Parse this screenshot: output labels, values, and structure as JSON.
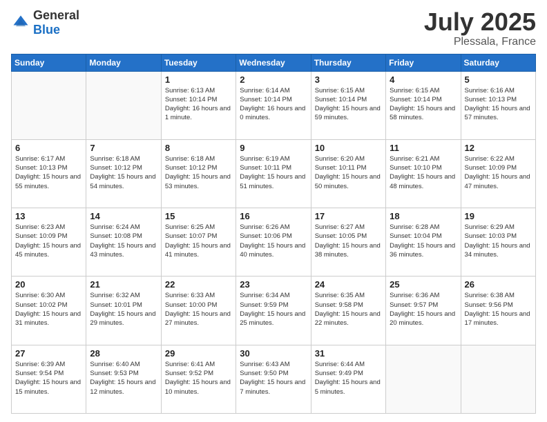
{
  "header": {
    "logo_general": "General",
    "logo_blue": "Blue",
    "month": "July 2025",
    "location": "Plessala, France"
  },
  "days_of_week": [
    "Sunday",
    "Monday",
    "Tuesday",
    "Wednesday",
    "Thursday",
    "Friday",
    "Saturday"
  ],
  "weeks": [
    [
      {
        "day": "",
        "info": ""
      },
      {
        "day": "",
        "info": ""
      },
      {
        "day": "1",
        "info": "Sunrise: 6:13 AM\nSunset: 10:14 PM\nDaylight: 16 hours and 1 minute."
      },
      {
        "day": "2",
        "info": "Sunrise: 6:14 AM\nSunset: 10:14 PM\nDaylight: 16 hours and 0 minutes."
      },
      {
        "day": "3",
        "info": "Sunrise: 6:15 AM\nSunset: 10:14 PM\nDaylight: 15 hours and 59 minutes."
      },
      {
        "day": "4",
        "info": "Sunrise: 6:15 AM\nSunset: 10:14 PM\nDaylight: 15 hours and 58 minutes."
      },
      {
        "day": "5",
        "info": "Sunrise: 6:16 AM\nSunset: 10:13 PM\nDaylight: 15 hours and 57 minutes."
      }
    ],
    [
      {
        "day": "6",
        "info": "Sunrise: 6:17 AM\nSunset: 10:13 PM\nDaylight: 15 hours and 55 minutes."
      },
      {
        "day": "7",
        "info": "Sunrise: 6:18 AM\nSunset: 10:12 PM\nDaylight: 15 hours and 54 minutes."
      },
      {
        "day": "8",
        "info": "Sunrise: 6:18 AM\nSunset: 10:12 PM\nDaylight: 15 hours and 53 minutes."
      },
      {
        "day": "9",
        "info": "Sunrise: 6:19 AM\nSunset: 10:11 PM\nDaylight: 15 hours and 51 minutes."
      },
      {
        "day": "10",
        "info": "Sunrise: 6:20 AM\nSunset: 10:11 PM\nDaylight: 15 hours and 50 minutes."
      },
      {
        "day": "11",
        "info": "Sunrise: 6:21 AM\nSunset: 10:10 PM\nDaylight: 15 hours and 48 minutes."
      },
      {
        "day": "12",
        "info": "Sunrise: 6:22 AM\nSunset: 10:09 PM\nDaylight: 15 hours and 47 minutes."
      }
    ],
    [
      {
        "day": "13",
        "info": "Sunrise: 6:23 AM\nSunset: 10:09 PM\nDaylight: 15 hours and 45 minutes."
      },
      {
        "day": "14",
        "info": "Sunrise: 6:24 AM\nSunset: 10:08 PM\nDaylight: 15 hours and 43 minutes."
      },
      {
        "day": "15",
        "info": "Sunrise: 6:25 AM\nSunset: 10:07 PM\nDaylight: 15 hours and 41 minutes."
      },
      {
        "day": "16",
        "info": "Sunrise: 6:26 AM\nSunset: 10:06 PM\nDaylight: 15 hours and 40 minutes."
      },
      {
        "day": "17",
        "info": "Sunrise: 6:27 AM\nSunset: 10:05 PM\nDaylight: 15 hours and 38 minutes."
      },
      {
        "day": "18",
        "info": "Sunrise: 6:28 AM\nSunset: 10:04 PM\nDaylight: 15 hours and 36 minutes."
      },
      {
        "day": "19",
        "info": "Sunrise: 6:29 AM\nSunset: 10:03 PM\nDaylight: 15 hours and 34 minutes."
      }
    ],
    [
      {
        "day": "20",
        "info": "Sunrise: 6:30 AM\nSunset: 10:02 PM\nDaylight: 15 hours and 31 minutes."
      },
      {
        "day": "21",
        "info": "Sunrise: 6:32 AM\nSunset: 10:01 PM\nDaylight: 15 hours and 29 minutes."
      },
      {
        "day": "22",
        "info": "Sunrise: 6:33 AM\nSunset: 10:00 PM\nDaylight: 15 hours and 27 minutes."
      },
      {
        "day": "23",
        "info": "Sunrise: 6:34 AM\nSunset: 9:59 PM\nDaylight: 15 hours and 25 minutes."
      },
      {
        "day": "24",
        "info": "Sunrise: 6:35 AM\nSunset: 9:58 PM\nDaylight: 15 hours and 22 minutes."
      },
      {
        "day": "25",
        "info": "Sunrise: 6:36 AM\nSunset: 9:57 PM\nDaylight: 15 hours and 20 minutes."
      },
      {
        "day": "26",
        "info": "Sunrise: 6:38 AM\nSunset: 9:56 PM\nDaylight: 15 hours and 17 minutes."
      }
    ],
    [
      {
        "day": "27",
        "info": "Sunrise: 6:39 AM\nSunset: 9:54 PM\nDaylight: 15 hours and 15 minutes."
      },
      {
        "day": "28",
        "info": "Sunrise: 6:40 AM\nSunset: 9:53 PM\nDaylight: 15 hours and 12 minutes."
      },
      {
        "day": "29",
        "info": "Sunrise: 6:41 AM\nSunset: 9:52 PM\nDaylight: 15 hours and 10 minutes."
      },
      {
        "day": "30",
        "info": "Sunrise: 6:43 AM\nSunset: 9:50 PM\nDaylight: 15 hours and 7 minutes."
      },
      {
        "day": "31",
        "info": "Sunrise: 6:44 AM\nSunset: 9:49 PM\nDaylight: 15 hours and 5 minutes."
      },
      {
        "day": "",
        "info": ""
      },
      {
        "day": "",
        "info": ""
      }
    ]
  ]
}
